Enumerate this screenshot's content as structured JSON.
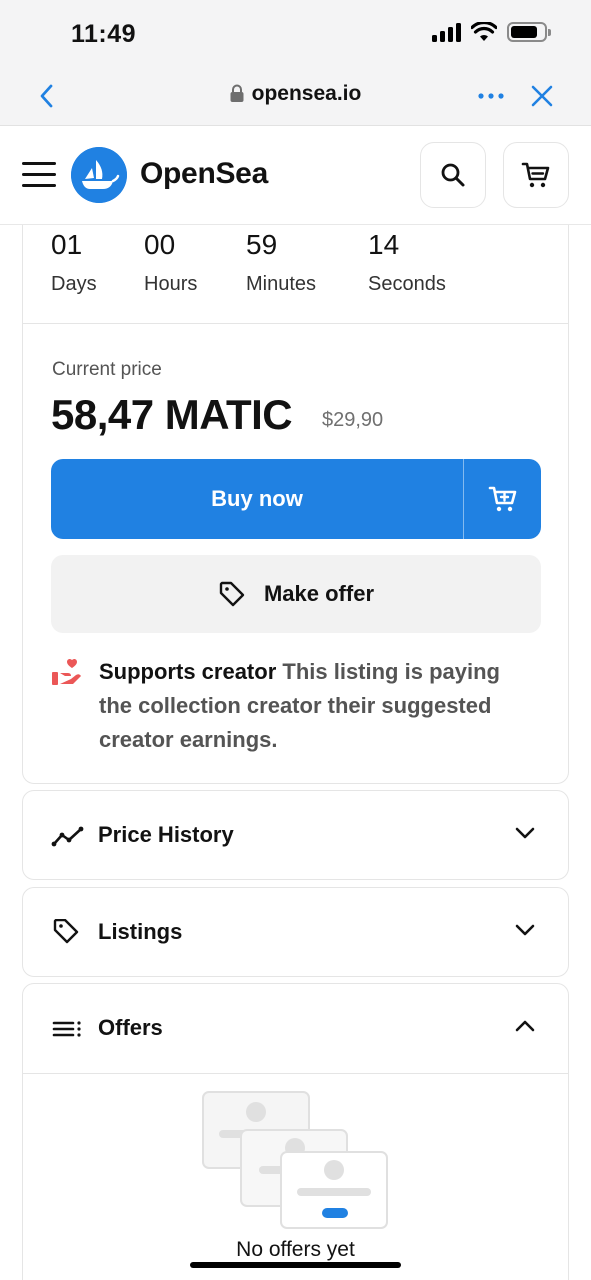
{
  "status_bar": {
    "time": "11:49"
  },
  "browser": {
    "url": "opensea.io"
  },
  "site": {
    "brand": "OpenSea"
  },
  "countdown": [
    {
      "value": "01",
      "label": "Days"
    },
    {
      "value": "00",
      "label": "Hours"
    },
    {
      "value": "59",
      "label": "Minutes"
    },
    {
      "value": "14",
      "label": "Seconds"
    }
  ],
  "price": {
    "label": "Current price",
    "amount": "58,47 MATIC",
    "fiat": "$29,90"
  },
  "actions": {
    "buy_now": "Buy now",
    "make_offer": "Make offer"
  },
  "supports": {
    "title": "Supports creator",
    "text": " This listing is paying the collection creator their suggested creator earnings."
  },
  "sections": {
    "price_history": "Price History",
    "listings": "Listings",
    "offers": "Offers"
  },
  "offers": {
    "empty_text": "No offers yet"
  },
  "colors": {
    "accent": "#2081e2",
    "heart": "#eb5757"
  }
}
